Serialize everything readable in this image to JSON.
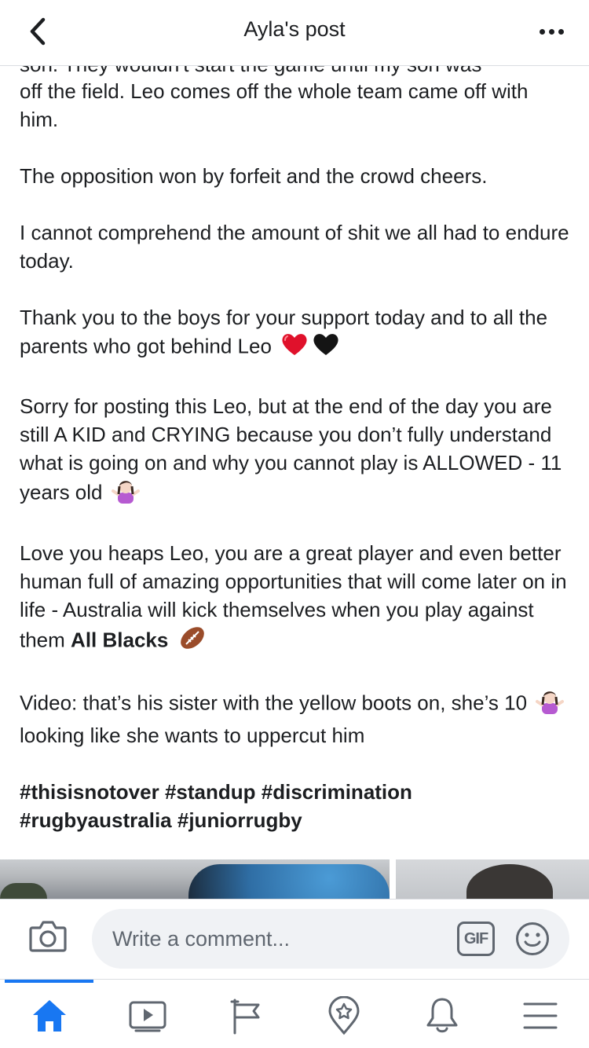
{
  "header": {
    "title": "Ayla's post",
    "back_icon": "chevron-left-icon",
    "more_icon": "more-horizontal-icon"
  },
  "post": {
    "cut_line": "son. They wouldn't start the game until my son was",
    "paragraphs": [
      "off the field. Leo comes off the whole team came off with him.",
      "The opposition won by forfeit and the crowd cheers.",
      "I cannot comprehend the amount of shit we all had to endure today.",
      "Thank you to the boys for your support today and to all the parents who got behind Leo",
      "Sorry for posting this Leo, but at the end of the day you are still A KID and CRYING because you don’t fully understand what is going on and why you cannot play is ALLOWED - 11 years old",
      "Love you heaps Leo, you are a great player and even better human full of amazing opportunities that will come later on in life - Australia will kick themselves when you play against them",
      "All Blacks",
      "Video: that’s his sister with the yellow boots on, she’s 10",
      "looking like she wants to uppercut him"
    ],
    "hashtags": [
      "#thisisnotover",
      "#standup",
      "#discrimination",
      "#rugbyaustralia",
      "#juniorrugby"
    ],
    "emojis": {
      "red_heart": "red-heart-icon",
      "black_heart": "black-heart-icon",
      "shrug": "person-shrugging-icon",
      "football": "football-icon"
    }
  },
  "comment_bar": {
    "placeholder": "Write a comment...",
    "gif_label": "GIF",
    "camera_icon": "camera-icon",
    "smiley_icon": "smiley-icon"
  },
  "tabbar": {
    "tabs": [
      {
        "icon": "home-icon",
        "active": true
      },
      {
        "icon": "video-icon",
        "active": false
      },
      {
        "icon": "pages-flag-icon",
        "active": false
      },
      {
        "icon": "explore-star-icon",
        "active": false
      },
      {
        "icon": "bell-icon",
        "active": false
      },
      {
        "icon": "menu-icon",
        "active": false
      }
    ]
  },
  "colors": {
    "accent": "#1877f2",
    "text": "#1c1e21",
    "muted": "#606770",
    "input_bg": "#f0f2f5"
  }
}
